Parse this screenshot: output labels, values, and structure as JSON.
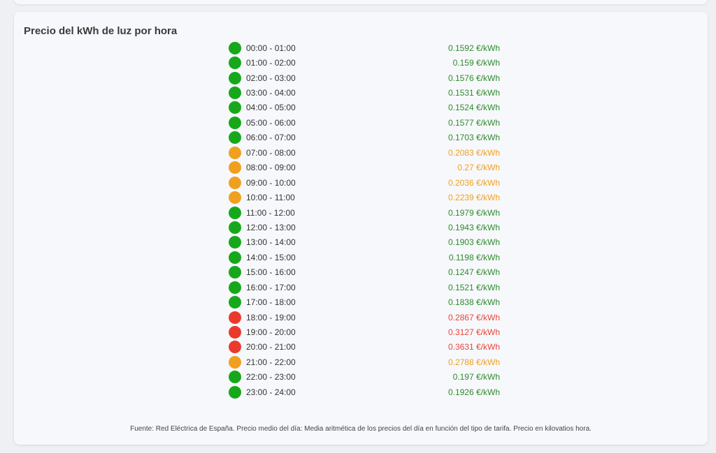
{
  "title": "Precio del kWh de luz por hora",
  "colors": {
    "low": "#16a81a",
    "mid": "#f0a020",
    "high": "#ea3a2e",
    "low_text": "#2e8b2e",
    "mid_text": "#f0a020",
    "high_text": "#e8453a"
  },
  "rows": [
    {
      "hour": "00:00 - 01:00",
      "price": "0.1592 €/kWh",
      "level": "low"
    },
    {
      "hour": "01:00 - 02:00",
      "price": "0.159 €/kWh",
      "level": "low"
    },
    {
      "hour": "02:00 - 03:00",
      "price": "0.1576 €/kWh",
      "level": "low"
    },
    {
      "hour": "03:00 - 04:00",
      "price": "0.1531 €/kWh",
      "level": "low"
    },
    {
      "hour": "04:00 - 05:00",
      "price": "0.1524 €/kWh",
      "level": "low"
    },
    {
      "hour": "05:00 - 06:00",
      "price": "0.1577 €/kWh",
      "level": "low"
    },
    {
      "hour": "06:00 - 07:00",
      "price": "0.1703 €/kWh",
      "level": "low"
    },
    {
      "hour": "07:00 - 08:00",
      "price": "0.2083 €/kWh",
      "level": "mid"
    },
    {
      "hour": "08:00 - 09:00",
      "price": "0.27 €/kWh",
      "level": "mid"
    },
    {
      "hour": "09:00 - 10:00",
      "price": "0.2036 €/kWh",
      "level": "mid"
    },
    {
      "hour": "10:00 - 11:00",
      "price": "0.2239 €/kWh",
      "level": "mid"
    },
    {
      "hour": "11:00 - 12:00",
      "price": "0.1979 €/kWh",
      "level": "low"
    },
    {
      "hour": "12:00 - 13:00",
      "price": "0.1943 €/kWh",
      "level": "low"
    },
    {
      "hour": "13:00 - 14:00",
      "price": "0.1903 €/kWh",
      "level": "low"
    },
    {
      "hour": "14:00 - 15:00",
      "price": "0.1198 €/kWh",
      "level": "low"
    },
    {
      "hour": "15:00 - 16:00",
      "price": "0.1247 €/kWh",
      "level": "low"
    },
    {
      "hour": "16:00 - 17:00",
      "price": "0.1521 €/kWh",
      "level": "low"
    },
    {
      "hour": "17:00 - 18:00",
      "price": "0.1838 €/kWh",
      "level": "low"
    },
    {
      "hour": "18:00 - 19:00",
      "price": "0.2867 €/kWh",
      "level": "high"
    },
    {
      "hour": "19:00 - 20:00",
      "price": "0.3127 €/kWh",
      "level": "high"
    },
    {
      "hour": "20:00 - 21:00",
      "price": "0.3631 €/kWh",
      "level": "high"
    },
    {
      "hour": "21:00 - 22:00",
      "price": "0.2788 €/kWh",
      "level": "mid"
    },
    {
      "hour": "22:00 - 23:00",
      "price": "0.197 €/kWh",
      "level": "low"
    },
    {
      "hour": "23:00 - 24:00",
      "price": "0.1926 €/kWh",
      "level": "low"
    }
  ],
  "footer": "Fuente: Red Eléctrica de España. Precio medio del día: Media aritmética de los precios del día en función del tipo de tarifa. Precio en kilovatios hora."
}
